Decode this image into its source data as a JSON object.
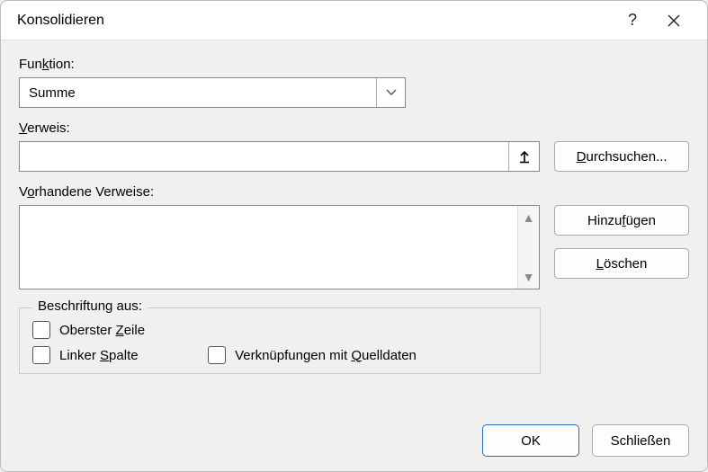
{
  "title": "Konsolidieren",
  "labels": {
    "function": "Funktion:",
    "function_u": "k",
    "reference": "Verweis:",
    "reference_u": "V",
    "existing": "Vorhandene Verweise:",
    "existing_u": "V",
    "group": "Beschriftung aus:"
  },
  "function_select": {
    "value": "Summe"
  },
  "reference_input": {
    "value": ""
  },
  "buttons": {
    "browse": "Durchsuchen...",
    "browse_u": "D",
    "add": "Hinzufügen",
    "add_u": "f",
    "delete": "Löschen",
    "delete_u": "L",
    "ok": "OK",
    "close": "Schließen"
  },
  "checks": {
    "top_row": "Oberster Zeile",
    "top_row_u": "Z",
    "left_col": "Linker Spalte",
    "left_col_u": "S",
    "links": "Verknüpfungen mit Quelldaten",
    "links_u": "Q"
  }
}
